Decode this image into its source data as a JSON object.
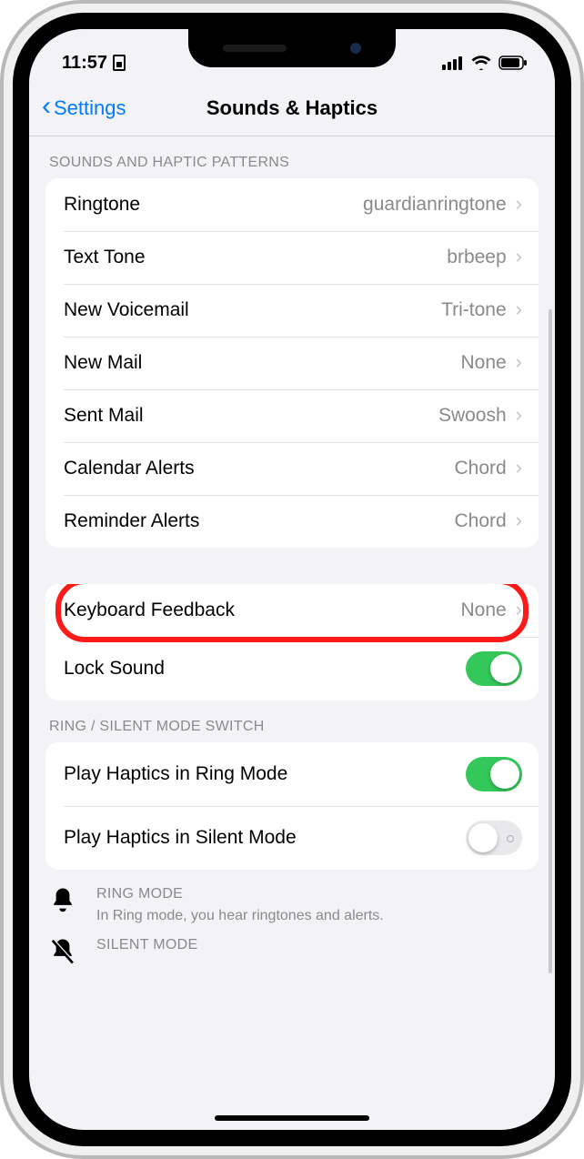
{
  "status": {
    "time": "11:57"
  },
  "nav": {
    "back": "Settings",
    "title": "Sounds & Haptics"
  },
  "sections": {
    "patterns": {
      "header": "SOUNDS AND HAPTIC PATTERNS",
      "rows": [
        {
          "label": "Ringtone",
          "value": "guardianringtone"
        },
        {
          "label": "Text Tone",
          "value": "brbeep"
        },
        {
          "label": "New Voicemail",
          "value": "Tri-tone"
        },
        {
          "label": "New Mail",
          "value": "None"
        },
        {
          "label": "Sent Mail",
          "value": "Swoosh"
        },
        {
          "label": "Calendar Alerts",
          "value": "Chord"
        },
        {
          "label": "Reminder Alerts",
          "value": "Chord"
        }
      ]
    },
    "feedback": {
      "rows": {
        "keyboard": {
          "label": "Keyboard Feedback",
          "value": "None"
        },
        "lock": {
          "label": "Lock Sound",
          "on": true
        }
      }
    },
    "ringsilent": {
      "header": "RING / SILENT MODE SWITCH",
      "rows": {
        "playRing": {
          "label": "Play Haptics in Ring Mode",
          "on": true
        },
        "playSilent": {
          "label": "Play Haptics in Silent Mode",
          "on": false
        }
      }
    },
    "info": {
      "ring": {
        "title": "RING MODE",
        "body": "In Ring mode, you hear ringtones and alerts."
      },
      "silent": {
        "title": "SILENT MODE"
      }
    }
  }
}
